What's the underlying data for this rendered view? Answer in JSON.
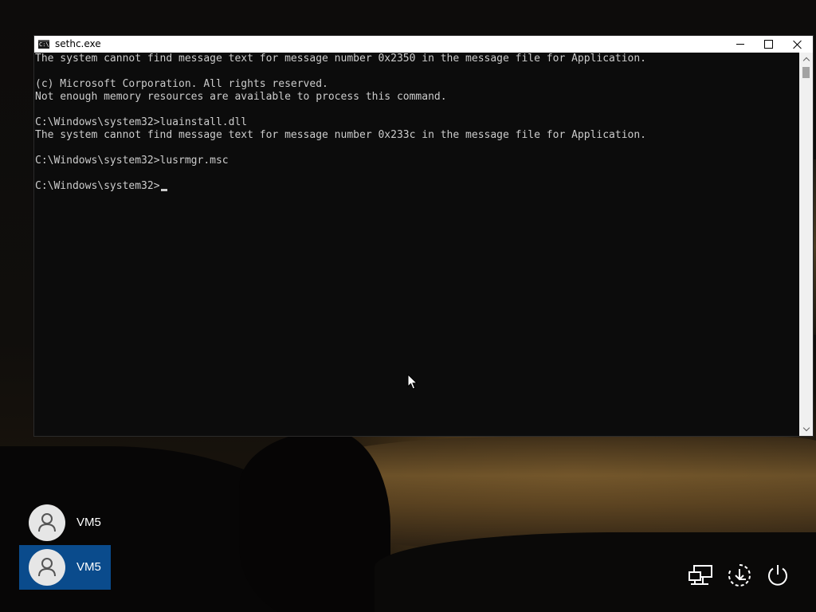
{
  "window": {
    "title": "sethc.exe",
    "icon_glyph": "C:\\",
    "icon": "console-icon"
  },
  "console": {
    "lines": [
      "The system cannot find message text for message number 0x2350 in the message file for Application.",
      "",
      "(c) Microsoft Corporation. All rights reserved.",
      "Not enough memory resources are available to process this command.",
      "",
      "C:\\Windows\\system32>luainstall.dll",
      "The system cannot find message text for message number 0x233c in the message file for Application.",
      "",
      "C:\\Windows\\system32>lusrmgr.msc",
      "",
      "C:\\Windows\\system32>"
    ]
  },
  "users": [
    {
      "name": "VM5",
      "selected": false
    },
    {
      "name": "VM5",
      "selected": true
    }
  ],
  "system_icons": [
    "network-icon",
    "ease-of-access-icon",
    "power-icon"
  ],
  "colors": {
    "console_bg": "#0c0c0c",
    "console_text": "#cccccc",
    "selected_user_bg": "#0a4b8c"
  }
}
